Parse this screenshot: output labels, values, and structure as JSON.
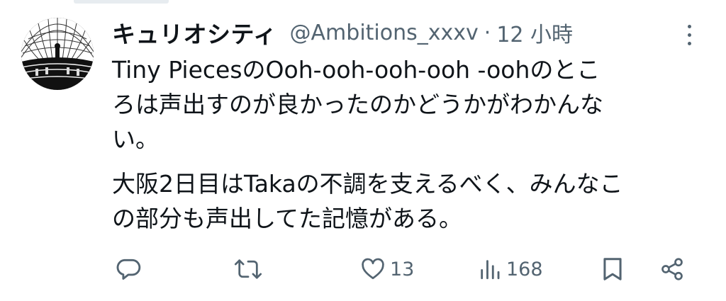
{
  "tweet": {
    "display_name": "キュリオシティ",
    "handle": "@Ambitions_xxxv",
    "separator": "·",
    "time": "12 小時",
    "lines": [
      "Tiny PiecesのOoh-ooh-ooh-ooh -oohのとこ",
      "ろは声出すのが良かったのかどうかがわかんな",
      "い。"
    ],
    "lines2": [
      "大阪2日目はTakaの不調を支えるべく、みんなこ",
      "の部分も声出してた記憶がある。"
    ]
  },
  "actions": {
    "reply": {
      "icon": "reply-icon"
    },
    "retweet": {
      "icon": "retweet-icon"
    },
    "like": {
      "icon": "heart-icon",
      "count": "13"
    },
    "views": {
      "icon": "analytics-icon",
      "count": "168"
    },
    "bookmark": {
      "icon": "bookmark-icon"
    },
    "share": {
      "icon": "share-icon"
    }
  },
  "colors": {
    "text": "#0f1419",
    "secondary": "#536471",
    "background": "#ffffff"
  }
}
